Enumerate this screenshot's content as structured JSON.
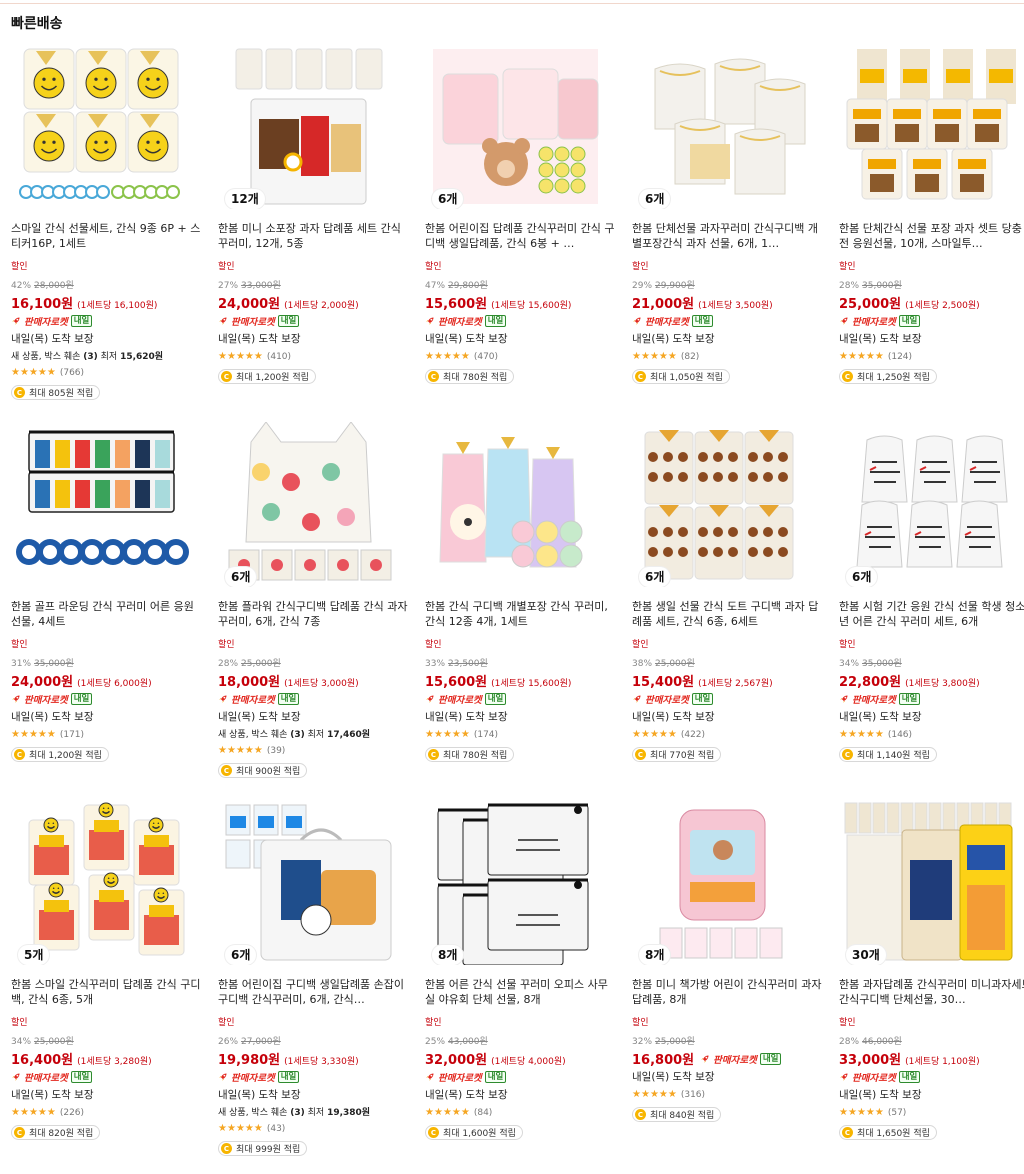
{
  "section": {
    "title": "빠른배송"
  },
  "colors": {
    "price": "#c5000a",
    "rocket": "#e2271e",
    "tomorrow": "#2e8b2e",
    "star": "#f5a623",
    "coin": "#f7b500"
  },
  "labels": {
    "sale": "할인",
    "rocket": "판매자로켓",
    "tomorrow": "내일",
    "delivery": "내일(목) 도착 보장"
  },
  "products": [
    {
      "name": "스마일 간식 선물세트, 간식 9종 6P + 스티커16P, 1세트",
      "qty": "",
      "img": "smiley",
      "discount": "42%",
      "orig": "28,000원",
      "price": "16,100원",
      "unit": "(1세트당 16,100원)",
      "rocket_inline": false,
      "delivery": "내일(목) 도착 보장",
      "newitem": {
        "pre": "새 상품, 박스 훼손 ",
        "count": "(3)",
        "mid": " 최저 ",
        "price": "15,620원"
      },
      "reviews": "(766)",
      "reward": "최대 805원 적립"
    },
    {
      "name": "한봄 미니 소포장 과자 답례품 세트 간식 꾸러미, 12개, 5종",
      "qty": "12개",
      "img": "box",
      "discount": "27%",
      "orig": "33,000원",
      "price": "24,000원",
      "unit": "(1세트당 2,000원)",
      "rocket_inline": false,
      "delivery": "내일(목) 도착 보장",
      "newitem": null,
      "reviews": "(410)",
      "reward": "최대 1,200원 적립"
    },
    {
      "name": "한봄 어린이집 답례품 간식꾸러미 간식 구디백 생일답례품, 간식 6봉 + …",
      "qty": "6개",
      "img": "bear",
      "discount": "47%",
      "orig": "29,800원",
      "price": "15,600원",
      "unit": "(1세트당 15,600원)",
      "rocket_inline": false,
      "delivery": "내일(목) 도착 보장",
      "newitem": null,
      "reviews": "(470)",
      "reward": "최대 780원 적립"
    },
    {
      "name": "한봄 단체선물 과자꾸러미 간식구디백 개별포장간식 과자 선물, 6개, 1…",
      "qty": "6개",
      "img": "drawstring",
      "discount": "29%",
      "orig": "29,900원",
      "price": "21,000원",
      "unit": "(1세트당 3,500원)",
      "rocket_inline": false,
      "delivery": "내일(목) 도착 보장",
      "newitem": null,
      "reviews": "(82)",
      "reward": "최대 1,050원 적립"
    },
    {
      "name": "한봄 단체간식 선물 포장 과자 셋트 당충전 응원선물, 10개, 스마일투…",
      "qty": "",
      "img": "kito",
      "discount": "28%",
      "orig": "35,000원",
      "price": "25,000원",
      "unit": "(1세트당 2,500원)",
      "rocket_inline": false,
      "delivery": "내일(목) 도착 보장",
      "newitem": null,
      "reviews": "(124)",
      "reward": "최대 1,250원 적립"
    },
    {
      "name": "한봄 골프 라운딩 간식 꾸러미 어른 응원 선물, 4세트",
      "qty": "",
      "img": "golf",
      "discount": "31%",
      "orig": "35,000원",
      "price": "24,000원",
      "unit": "(1세트당 6,000원)",
      "rocket_inline": false,
      "delivery": "내일(목) 도착 보장",
      "newitem": null,
      "reviews": "(171)",
      "reward": "최대 1,200원 적립"
    },
    {
      "name": "한봄 플라워 간식구디백 답례품 간식 과자 꾸러미, 6개, 간식 7종",
      "qty": "6개",
      "img": "flower",
      "discount": "28%",
      "orig": "25,000원",
      "price": "18,000원",
      "unit": "(1세트당 3,000원)",
      "rocket_inline": false,
      "delivery": "내일(목) 도착 보장",
      "newitem": {
        "pre": "새 상품, 박스 훼손 ",
        "count": "(3)",
        "mid": " 최저 ",
        "price": "17,460원"
      },
      "reviews": "(39)",
      "reward": "최대 900원 적립"
    },
    {
      "name": "한봄 간식 구디백 개별포장 간식 꾸러미, 간식 12종 4개, 1세트",
      "qty": "",
      "img": "happy",
      "discount": "33%",
      "orig": "23,500원",
      "price": "15,600원",
      "unit": "(1세트당 15,600원)",
      "rocket_inline": false,
      "delivery": "내일(목) 도착 보장",
      "newitem": null,
      "reviews": "(174)",
      "reward": "최대 780원 적립"
    },
    {
      "name": "한봄 생일 선물 간식 도트 구디백 과자 답례품 세트, 간식 6종, 6세트",
      "qty": "6개",
      "img": "dots",
      "discount": "38%",
      "orig": "25,000원",
      "price": "15,400원",
      "unit": "(1세트당 2,567원)",
      "rocket_inline": false,
      "delivery": "내일(목) 도착 보장",
      "newitem": null,
      "reviews": "(422)",
      "reward": "최대 770원 적립"
    },
    {
      "name": "한봄 시험 기간 응원 간식 선물 학생 청소년 어른 간식 꾸러미 세트, 6개",
      "qty": "6개",
      "img": "whitebag",
      "discount": "34%",
      "orig": "35,000원",
      "price": "22,800원",
      "unit": "(1세트당 3,800원)",
      "rocket_inline": false,
      "delivery": "내일(목) 도착 보장",
      "newitem": null,
      "reviews": "(146)",
      "reward": "최대 1,140원 적립"
    },
    {
      "name": "한봄 스마일 간식꾸러미 답례품 간식 구디백, 간식 6종, 5개",
      "qty": "5개",
      "img": "smiletie",
      "discount": "34%",
      "orig": "25,000원",
      "price": "16,400원",
      "unit": "(1세트당 3,280원)",
      "rocket_inline": false,
      "delivery": "내일(목) 도착 보장",
      "newitem": null,
      "reviews": "(226)",
      "reward": "최대 820원 적립"
    },
    {
      "name": "한봄 어린이집 구디백 생일답례품 손잡이구디백 간식꾸러미, 6개, 간식…",
      "qty": "6개",
      "img": "handle",
      "discount": "26%",
      "orig": "27,000원",
      "price": "19,980원",
      "unit": "(1세트당 3,330원)",
      "rocket_inline": false,
      "delivery": "내일(목) 도착 보장",
      "newitem": {
        "pre": "새 상품, 박스 훼손 ",
        "count": "(3)",
        "mid": " 최저 ",
        "price": "19,380원"
      },
      "reviews": "(43)",
      "reward": "최대 999원 적립"
    },
    {
      "name": "한봄 어른 간식 선물 꾸러미 오피스 사무실 야유회 단체 선물, 8개",
      "qty": "8개",
      "img": "zipper",
      "discount": "25%",
      "orig": "43,000원",
      "price": "32,000원",
      "unit": "(1세트당 4,000원)",
      "rocket_inline": false,
      "delivery": "내일(목) 도착 보장",
      "newitem": null,
      "reviews": "(84)",
      "reward": "최대 1,600원 적립"
    },
    {
      "name": "한봄 미니 책가방 어린이 간식꾸러미 과자답례품, 8개",
      "qty": "8개",
      "img": "backpack",
      "discount": "32%",
      "orig": "25,000원",
      "price": "16,800원",
      "unit": "",
      "rocket_inline": true,
      "delivery": "내일(목) 도착 보장",
      "newitem": null,
      "reviews": "(316)",
      "reward": "최대 840원 적립"
    },
    {
      "name": "한봄 과자답례품 간식꾸러미 미니과자세트 간식구디백 단체선물, 30…",
      "qty": "30개",
      "img": "snacks",
      "discount": "28%",
      "orig": "46,000원",
      "price": "33,000원",
      "unit": "(1세트당 1,100원)",
      "rocket_inline": false,
      "delivery": "내일(목) 도착 보장",
      "newitem": null,
      "reviews": "(57)",
      "reward": "최대 1,650원 적립"
    }
  ]
}
